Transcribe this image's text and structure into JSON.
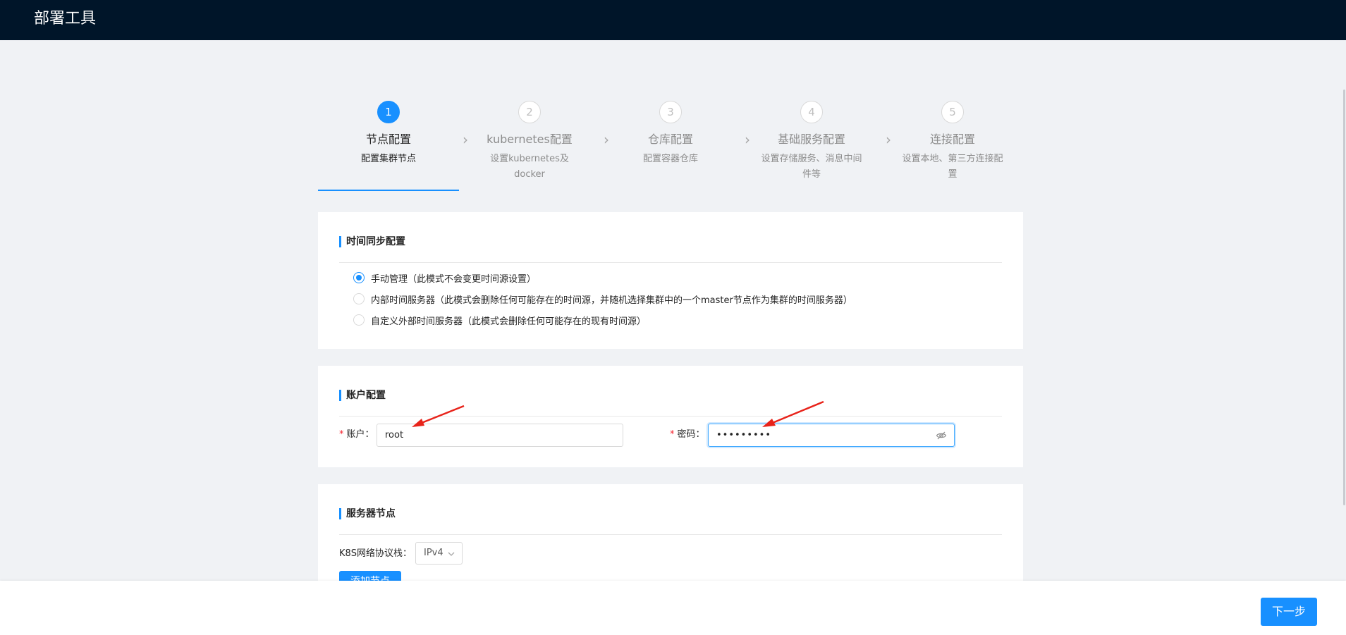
{
  "app": {
    "title": "部署工具"
  },
  "steps": [
    {
      "num": "1",
      "title": "节点配置",
      "desc": "配置集群节点",
      "active": true
    },
    {
      "num": "2",
      "title": "kubernetes配置",
      "desc": "设置kubernetes及docker",
      "active": false
    },
    {
      "num": "3",
      "title": "仓库配置",
      "desc": "配置容器仓库",
      "active": false
    },
    {
      "num": "4",
      "title": "基础服务配置",
      "desc": "设置存储服务、消息中间件等",
      "active": false
    },
    {
      "num": "5",
      "title": "连接配置",
      "desc": "设置本地、第三方连接配置",
      "active": false
    }
  ],
  "time_sync": {
    "title": "时间同步配置",
    "options": [
      {
        "label": "手动管理（此模式不会变更时间源设置）",
        "checked": true
      },
      {
        "label": "内部时间服务器（此模式会删除任何可能存在的时间源，并随机选择集群中的一个master节点作为集群的时间服务器）",
        "checked": false
      },
      {
        "label": "自定义外部时间服务器（此模式会删除任何可能存在的现有时间源）",
        "checked": false
      }
    ]
  },
  "account": {
    "title": "账户配置",
    "account_label": "账户：",
    "account_value": "root",
    "password_label": "密码：",
    "password_value": "•••••••••"
  },
  "server_nodes": {
    "title": "服务器节点",
    "protocol_label": "K8S网络协议栈：",
    "protocol_value": "IPv4",
    "add_node_label": "添加节点"
  },
  "footer": {
    "next_label": "下一步"
  },
  "colors": {
    "primary": "#1890ff",
    "header_bg": "#001529",
    "annotation": "#e8231a"
  }
}
